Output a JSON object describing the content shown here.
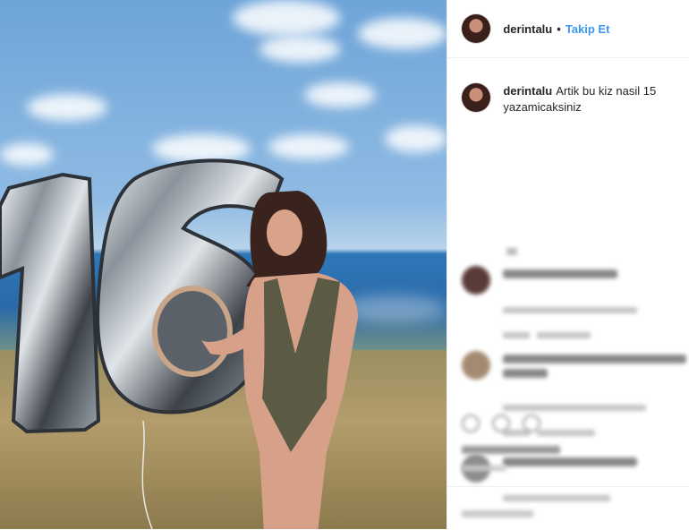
{
  "post": {
    "author_username": "derintalu",
    "follow_label": "Takip Et",
    "separator": "•",
    "caption_username": "derintalu",
    "caption_text": "Artik bu kiz nasil 15 yazamicaksiniz"
  },
  "photo": {
    "balloon_text": "16"
  },
  "colors": {
    "link_blue": "#3897f0",
    "text": "#262626",
    "border": "#efefef"
  },
  "icons": [
    "heart-icon",
    "comment-icon",
    "share-icon"
  ]
}
